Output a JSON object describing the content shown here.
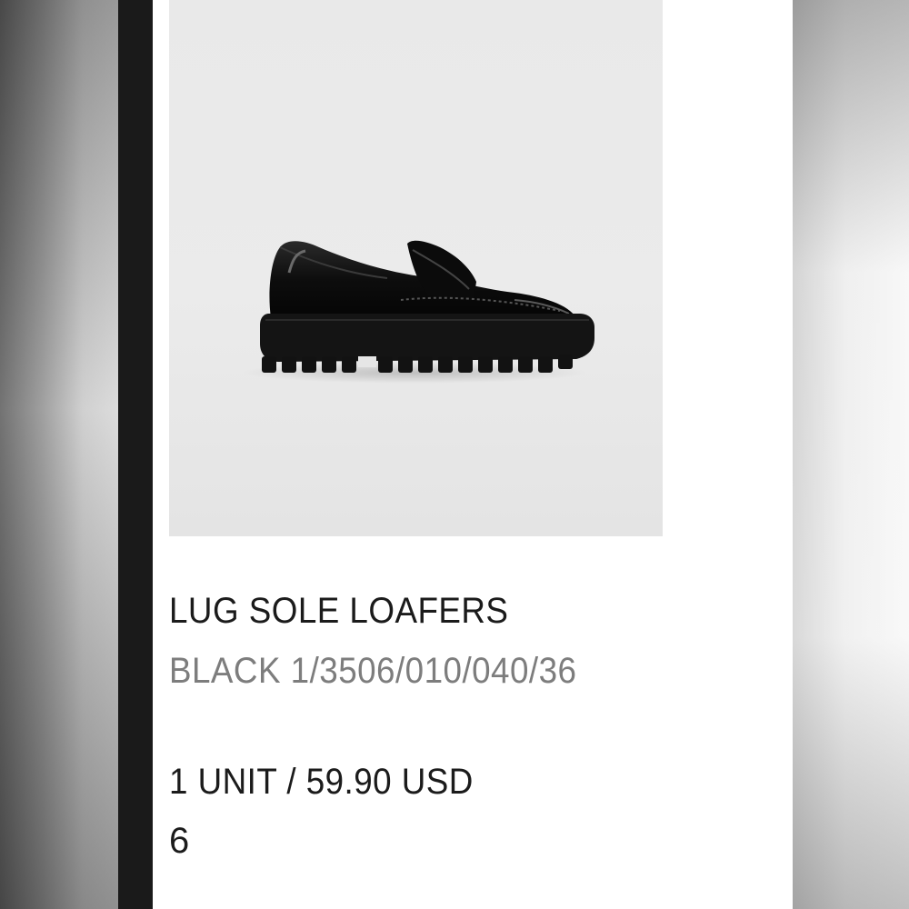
{
  "product": {
    "name": "LUG SOLE LOAFERS",
    "reference": "BLACK 1/3506/010/040/36",
    "price_line": "1 UNIT / 59.90 USD",
    "size": "6",
    "image": "black-lug-sole-loafer-photo"
  },
  "colors": {
    "text_primary": "#1b1b1b",
    "text_secondary": "#7d7d7d",
    "image_background": "#e9e9e9",
    "shoe": "#121212"
  }
}
